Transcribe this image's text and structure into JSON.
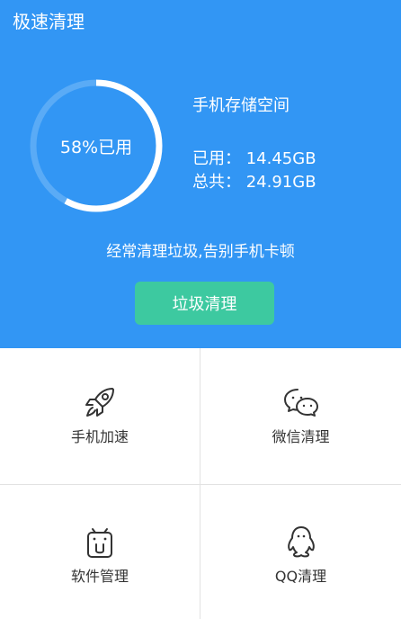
{
  "header": {
    "title": "极速清理"
  },
  "storage": {
    "ring_text": "58%已用",
    "used_fraction": 0.58,
    "label": "手机存储空间",
    "used_line": "已用：  14.45GB",
    "total_line": "总共：  24.91GB"
  },
  "tip": "经常清理垃圾,告别手机卡顿",
  "clean_button": "垃圾清理",
  "tiles": [
    {
      "label": "手机加速",
      "icon": "rocket-icon"
    },
    {
      "label": "微信清理",
      "icon": "wechat-icon"
    },
    {
      "label": "软件管理",
      "icon": "android-app-icon"
    },
    {
      "label": "QQ清理",
      "icon": "qq-penguin-icon"
    }
  ],
  "colors": {
    "primary_blue": "#3296f4",
    "button_green": "#3dc9a0",
    "ring_track": "#5aabf6"
  }
}
